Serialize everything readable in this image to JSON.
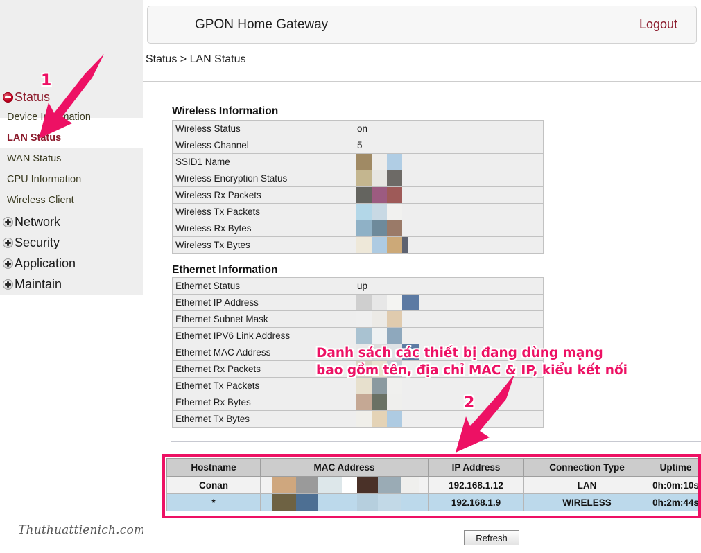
{
  "header": {
    "app_title": "GPON Home Gateway",
    "logout_label": "Logout",
    "breadcrumb": "Status > LAN Status"
  },
  "sidebar": {
    "roots": [
      {
        "label": "Status",
        "icon": "minus-circle-icon",
        "expanded": true
      },
      {
        "label": "Network",
        "icon": "plus-circle-icon",
        "expanded": false
      },
      {
        "label": "Security",
        "icon": "plus-circle-icon",
        "expanded": false
      },
      {
        "label": "Application",
        "icon": "plus-circle-icon",
        "expanded": false
      },
      {
        "label": "Maintain",
        "icon": "plus-circle-icon",
        "expanded": false
      }
    ],
    "status_children": [
      {
        "label": "Device Information",
        "active": false
      },
      {
        "label": "LAN Status",
        "active": true
      },
      {
        "label": "WAN Status",
        "active": false
      },
      {
        "label": "CPU Information",
        "active": false
      },
      {
        "label": "Wireless Client",
        "active": false
      }
    ]
  },
  "watermark": "Thuthuattienich.com",
  "wireless": {
    "section_title": "Wireless Information",
    "rows": [
      {
        "key": "Wireless Status",
        "value": "on",
        "censored": false
      },
      {
        "key": "Wireless Channel",
        "value": "5",
        "censored": false
      },
      {
        "key": "SSID1 Name",
        "value": "",
        "censored": true
      },
      {
        "key": "Wireless Encryption Status",
        "value": "",
        "censored": true
      },
      {
        "key": "Wireless Rx Packets",
        "value": "",
        "censored": true
      },
      {
        "key": "Wireless Tx Packets",
        "value": "",
        "censored": true
      },
      {
        "key": "Wireless Rx Bytes",
        "value": "",
        "censored": true
      },
      {
        "key": "Wireless Tx Bytes",
        "value": "",
        "censored": true
      }
    ]
  },
  "ethernet": {
    "section_title": "Ethernet Information",
    "rows": [
      {
        "key": "Ethernet Status",
        "value": "up",
        "censored": false
      },
      {
        "key": "Ethernet IP Address",
        "value": "",
        "censored": true
      },
      {
        "key": "Ethernet Subnet Mask",
        "value": "",
        "censored": true
      },
      {
        "key": "Ethernet IPV6 Link Address",
        "value": "",
        "censored": true
      },
      {
        "key": "Ethernet MAC Address",
        "value": "",
        "censored": true
      },
      {
        "key": "Ethernet Rx Packets",
        "value": "",
        "censored": true
      },
      {
        "key": "Ethernet Tx Packets",
        "value": "",
        "censored": true
      },
      {
        "key": "Ethernet Rx Bytes",
        "value": "",
        "censored": true
      },
      {
        "key": "Ethernet Tx Bytes",
        "value": "",
        "censored": true
      }
    ]
  },
  "devices": {
    "columns": [
      "Hostname",
      "MAC Address",
      "IP Address",
      "Connection Type",
      "Uptime"
    ],
    "rows": [
      {
        "hostname": "Conan",
        "mac": "",
        "mac_censored": true,
        "ip": "192.168.1.12",
        "connection": "LAN",
        "uptime": "0h:0m:10s"
      },
      {
        "hostname": "*",
        "mac": "",
        "mac_censored": true,
        "ip": "192.168.1.9",
        "connection": "WIRELESS",
        "uptime": "0h:2m:44s"
      }
    ]
  },
  "refresh_button": "Refresh",
  "annotations": {
    "marker_1": "1",
    "marker_2": "2",
    "note_text": "Danh sách các thiết bị đang dùng mạng\nbao gồm tên, địa chỉ MAC & IP, kiểu kết nối",
    "accent_color": "#ED1164"
  }
}
